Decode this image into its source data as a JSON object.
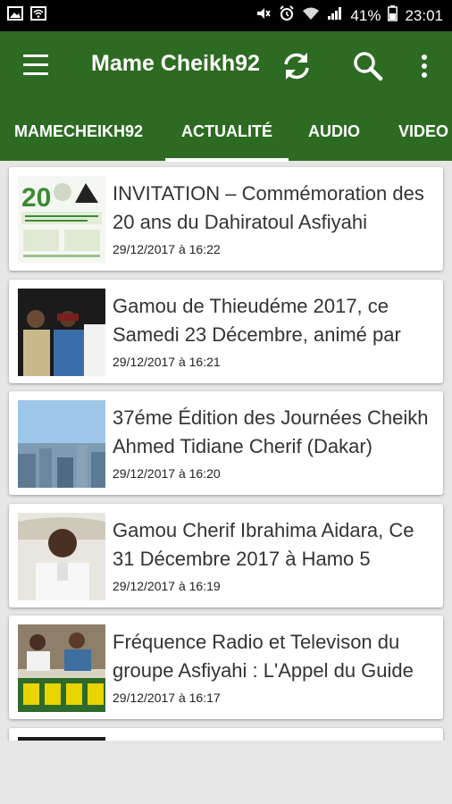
{
  "status_bar": {
    "battery_percent": "41%",
    "time": "23:01",
    "left_icons": [
      "image-icon",
      "wifi-shield-icon"
    ],
    "right_icons": [
      "mute-icon",
      "alarm-icon",
      "wifi-icon",
      "signal-icon",
      "battery-icon"
    ]
  },
  "app_bar": {
    "title": "Mame Cheikh92",
    "background": "#2d6b22",
    "icons": [
      "menu-icon",
      "refresh-icon",
      "search-icon",
      "overflow-menu-icon"
    ]
  },
  "tabs": [
    {
      "label": "MAMECHEIKH92"
    },
    {
      "label": "ACTUALITÉ",
      "selected": true
    },
    {
      "label": "AUDIO"
    },
    {
      "label": "VIDEO"
    }
  ],
  "articles": [
    {
      "title": "INVITATION – Commémoration des 20 ans du Dahiratoul Asfiyahi",
      "date": "29/12/2017 à 16:22"
    },
    {
      "title": "Gamou de Thieudéme 2017, ce Samedi 23 Décembre, animé par",
      "date": "29/12/2017 à 16:21"
    },
    {
      "title": "37éme Édition des Journées Cheikh Ahmed Tidiane Cherif (Dakar)",
      "date": "29/12/2017 à 16:20"
    },
    {
      "title": "Gamou Cherif Ibrahima Aidara, Ce 31 Décembre 2017 à Hamo 5",
      "date": "29/12/2017 à 16:19"
    },
    {
      "title": "Fréquence Radio et Televison du groupe Asfiyahi : L'Appel du Guide",
      "date": "29/12/2017 à 16:17"
    }
  ]
}
